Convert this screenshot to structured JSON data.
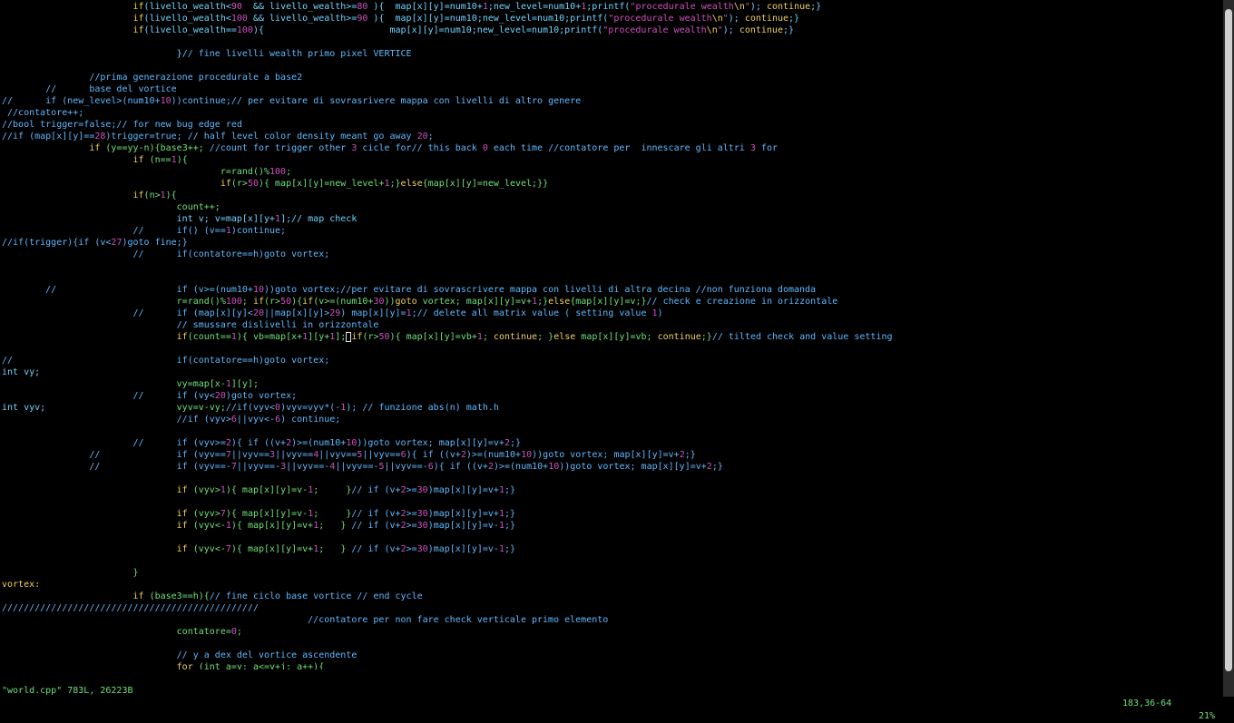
{
  "colors": {
    "background": "#000000",
    "default": "#6fd3ff",
    "keyword": "#f0d060",
    "number": "#d050c0",
    "string": "#d050c0",
    "comment": "#5fb8ff",
    "identifier": "#6fe07a",
    "status": "#6fe07a",
    "scrollbar": "#2b2b2b",
    "scroll_thumb": "#cfcfcf"
  },
  "editor": {
    "lines": [
      [
        [
          "d",
          "                        "
        ],
        [
          "k",
          "if"
        ],
        [
          "d",
          "(livello_wealth<"
        ],
        [
          "n",
          "90"
        ],
        [
          "d",
          "  && livello_wealth>="
        ],
        [
          "n",
          "80"
        ],
        [
          "d",
          " ){  map[x][y]=num10+"
        ],
        [
          "n",
          "1"
        ],
        [
          "d",
          ";new_level=num10+"
        ],
        [
          "n",
          "1"
        ],
        [
          "d",
          ";printf("
        ],
        [
          "s",
          "\"procedurale wealth"
        ],
        [
          "k",
          "\\n"
        ],
        [
          "s",
          "\""
        ],
        [
          "d",
          "); "
        ],
        [
          "k",
          "continue"
        ],
        [
          "d",
          ";}"
        ]
      ],
      [
        [
          "d",
          "                        "
        ],
        [
          "k",
          "if"
        ],
        [
          "d",
          "(livello_wealth<"
        ],
        [
          "n",
          "100"
        ],
        [
          "d",
          " && livello_wealth>="
        ],
        [
          "n",
          "90"
        ],
        [
          "d",
          " ){  map[x][y]=num10;new_level=num10;printf("
        ],
        [
          "s",
          "\"procedurale wealth"
        ],
        [
          "k",
          "\\n"
        ],
        [
          "s",
          "\""
        ],
        [
          "d",
          "); "
        ],
        [
          "k",
          "continue"
        ],
        [
          "d",
          ";}"
        ]
      ],
      [
        [
          "d",
          "                        "
        ],
        [
          "k",
          "if"
        ],
        [
          "d",
          "(livello_wealth=="
        ],
        [
          "n",
          "100"
        ],
        [
          "d",
          "){                       map[x][y]=num10;new_level=num10;printf("
        ],
        [
          "s",
          "\"procedurale wealth"
        ],
        [
          "k",
          "\\n"
        ],
        [
          "s",
          "\""
        ],
        [
          "d",
          "); "
        ],
        [
          "k",
          "continue"
        ],
        [
          "d",
          ";}"
        ]
      ],
      [],
      [
        [
          "d",
          "                                }"
        ],
        [
          "c",
          "// fine livelli wealth primo pixel VERTICE"
        ]
      ],
      [],
      [
        [
          "c",
          "                //prima generazione procedurale a base2"
        ]
      ],
      [
        [
          "c",
          "        //      base del vortice"
        ]
      ],
      [
        [
          "c",
          "//      if (new_level>(num10+"
        ],
        [
          "n",
          "10"
        ],
        [
          "c",
          "))continue;// per evitare di sovrasrivere mappa con livelli di altro genere"
        ]
      ],
      [
        [
          "c",
          " //contatore++;"
        ]
      ],
      [
        [
          "c",
          "//bool trigger=false;// for new bug edge red"
        ]
      ],
      [
        [
          "c",
          "//if (map[x][y]=="
        ],
        [
          "n",
          "28"
        ],
        [
          "c",
          ")trigger=true; // half level color density meant go away "
        ],
        [
          "n",
          "20"
        ],
        [
          "c",
          ";"
        ]
      ],
      [
        [
          "d",
          "                "
        ],
        [
          "k",
          "if"
        ],
        [
          "d",
          " "
        ],
        [
          "i",
          "(y==yy-n){base3++;"
        ],
        [
          "c",
          " //count for trigger other "
        ],
        [
          "n",
          "3"
        ],
        [
          "c",
          " cicle for// this back "
        ],
        [
          "n",
          "0"
        ],
        [
          "c",
          " each time //contatore per  innescare gli altri "
        ],
        [
          "n",
          "3"
        ],
        [
          "c",
          " for"
        ]
      ],
      [
        [
          "d",
          "                        "
        ],
        [
          "k",
          "if"
        ],
        [
          "d",
          " "
        ],
        [
          "i",
          "(n=="
        ],
        [
          "n",
          "1"
        ],
        [
          "i",
          "){"
        ]
      ],
      [
        [
          "d",
          "                                        "
        ],
        [
          "i",
          "r=rand()%"
        ],
        [
          "n",
          "100"
        ],
        [
          "i",
          ";"
        ]
      ],
      [
        [
          "d",
          "                                        "
        ],
        [
          "k",
          "if"
        ],
        [
          "i",
          "(r>"
        ],
        [
          "n",
          "50"
        ],
        [
          "i",
          "){ map[x][y]=new_level+"
        ],
        [
          "n",
          "1"
        ],
        [
          "i",
          ";}"
        ],
        [
          "k",
          "else"
        ],
        [
          "i",
          "{map[x][y]=new_level;}}"
        ]
      ],
      [
        [
          "d",
          "                        "
        ],
        [
          "k",
          "if"
        ],
        [
          "i",
          "(n>"
        ],
        [
          "n",
          "1"
        ],
        [
          "i",
          "){"
        ]
      ],
      [
        [
          "d",
          "                                "
        ],
        [
          "i",
          "count++;"
        ]
      ],
      [
        [
          "d",
          "                                "
        ],
        [
          "d",
          "int v; v=map[x][y+"
        ],
        [
          "n",
          "1"
        ],
        [
          "d",
          "];// map check"
        ]
      ],
      [
        [
          "c",
          "                        //      if() (v=="
        ],
        [
          "n",
          "1"
        ],
        [
          "c",
          ")continue;"
        ]
      ],
      [
        [
          "c",
          "//if(trigger){if (v<"
        ],
        [
          "n",
          "27"
        ],
        [
          "c",
          ")goto fine;}"
        ]
      ],
      [
        [
          "c",
          "                        //      if(contatore==h)goto vortex;"
        ]
      ],
      [],
      [],
      [
        [
          "c",
          "        //                      if (v>=(num10+"
        ],
        [
          "n",
          "10"
        ],
        [
          "c",
          "))goto vortex;//per evitare di sovrascrivere mappa con livelli di altra decina //non funziona domanda"
        ]
      ],
      [
        [
          "d",
          "                                "
        ],
        [
          "i",
          "r=rand()%"
        ],
        [
          "n",
          "100"
        ],
        [
          "i",
          "; "
        ],
        [
          "k",
          "if"
        ],
        [
          "i",
          "(r>"
        ],
        [
          "n",
          "50"
        ],
        [
          "i",
          "){"
        ],
        [
          "k",
          "if"
        ],
        [
          "i",
          "(v>=(num10+"
        ],
        [
          "n",
          "30"
        ],
        [
          "i",
          "))"
        ],
        [
          "k",
          "goto"
        ],
        [
          "i",
          " vortex; map[x][y]=v+"
        ],
        [
          "n",
          "1"
        ],
        [
          "i",
          ";}"
        ],
        [
          "k",
          "else"
        ],
        [
          "i",
          "{map[x][y]=v;}"
        ],
        [
          "c",
          "// check e creazione in orizzontale"
        ]
      ],
      [
        [
          "c",
          "                        //      if (map[x][y]<"
        ],
        [
          "n",
          "20"
        ],
        [
          "c",
          "||map[x][y]>"
        ],
        [
          "n",
          "29"
        ],
        [
          "c",
          ") map[x][y]="
        ],
        [
          "n",
          "1"
        ],
        [
          "c",
          ";// delete all matrix value ( setting value "
        ],
        [
          "n",
          "1"
        ],
        [
          "c",
          ")"
        ]
      ],
      [
        [
          "c",
          "                                // smussare dislivelli in orizzontale"
        ]
      ],
      [
        [
          "d",
          "                                "
        ],
        [
          "k",
          "if"
        ],
        [
          "i",
          "(count=="
        ],
        [
          "n",
          "1"
        ],
        [
          "i",
          "){ vb=map[x+"
        ],
        [
          "n",
          "1"
        ],
        [
          "i",
          "][y+"
        ],
        [
          "n",
          "1"
        ],
        [
          "i",
          "];"
        ],
        [
          "cur",
          " "
        ],
        [
          "k",
          "if"
        ],
        [
          "i",
          "(r>"
        ],
        [
          "n",
          "50"
        ],
        [
          "i",
          "){ map[x][y]=vb+"
        ],
        [
          "n",
          "1"
        ],
        [
          "i",
          "; "
        ],
        [
          "k",
          "continue"
        ],
        [
          "i",
          "; }"
        ],
        [
          "k",
          "else"
        ],
        [
          "i",
          " map[x][y]=vb; "
        ],
        [
          "k",
          "continue"
        ],
        [
          "i",
          ";}"
        ],
        [
          "c",
          "// tilted check and value setting"
        ]
      ],
      [],
      [
        [
          "c",
          "//                              if(contatore==h)goto vortex;"
        ]
      ],
      [
        [
          "d",
          "int vy;"
        ]
      ],
      [
        [
          "d",
          "                                "
        ],
        [
          "i",
          "vy=map[x-"
        ],
        [
          "n",
          "1"
        ],
        [
          "i",
          "][y];"
        ]
      ],
      [
        [
          "c",
          "                        //      if (vy<"
        ],
        [
          "n",
          "20"
        ],
        [
          "c",
          ")goto vortex;"
        ]
      ],
      [
        [
          "d",
          "int vyv;                        "
        ],
        [
          "i",
          "vyv=v-vy;"
        ],
        [
          "c",
          "//if(vyv<"
        ],
        [
          "n",
          "0"
        ],
        [
          "c",
          ")vyv=vyv*(-"
        ],
        [
          "n",
          "1"
        ],
        [
          "c",
          "); // funzione abs(n) math.h"
        ]
      ],
      [
        [
          "c",
          "                                //if (vyv>"
        ],
        [
          "n",
          "6"
        ],
        [
          "c",
          "||vyv<-"
        ],
        [
          "n",
          "6"
        ],
        [
          "c",
          ") continue;"
        ]
      ],
      [],
      [
        [
          "c",
          "                        //      if (vyv>="
        ],
        [
          "n",
          "2"
        ],
        [
          "c",
          "){ if ((v+"
        ],
        [
          "n",
          "2"
        ],
        [
          "c",
          ")>=(num10+"
        ],
        [
          "n",
          "10"
        ],
        [
          "c",
          "))goto vortex; map[x][y]=v+"
        ],
        [
          "n",
          "2"
        ],
        [
          "c",
          ";}"
        ]
      ],
      [
        [
          "c",
          "                //              if (vyv=="
        ],
        [
          "n",
          "7"
        ],
        [
          "c",
          "||vyv=="
        ],
        [
          "n",
          "3"
        ],
        [
          "c",
          "||vyv=="
        ],
        [
          "n",
          "4"
        ],
        [
          "c",
          "||vyv=="
        ],
        [
          "n",
          "5"
        ],
        [
          "c",
          "||vyv=="
        ],
        [
          "n",
          "6"
        ],
        [
          "c",
          "){ if ((v+"
        ],
        [
          "n",
          "2"
        ],
        [
          "c",
          ")>=(num10+"
        ],
        [
          "n",
          "10"
        ],
        [
          "c",
          "))goto vortex; map[x][y]=v+"
        ],
        [
          "n",
          "2"
        ],
        [
          "c",
          ";}"
        ]
      ],
      [
        [
          "c",
          "                //              if (vyv==-"
        ],
        [
          "n",
          "7"
        ],
        [
          "c",
          "||vyv==-"
        ],
        [
          "n",
          "3"
        ],
        [
          "c",
          "||vyv==-"
        ],
        [
          "n",
          "4"
        ],
        [
          "c",
          "||vyv==-"
        ],
        [
          "n",
          "5"
        ],
        [
          "c",
          "||vyv==-"
        ],
        [
          "n",
          "6"
        ],
        [
          "c",
          "){ if ((v+"
        ],
        [
          "n",
          "2"
        ],
        [
          "c",
          ")>=(num10+"
        ],
        [
          "n",
          "10"
        ],
        [
          "c",
          "))goto vortex; map[x][y]=v+"
        ],
        [
          "n",
          "2"
        ],
        [
          "c",
          ";}"
        ]
      ],
      [],
      [
        [
          "d",
          "                                "
        ],
        [
          "k",
          "if"
        ],
        [
          "d",
          " "
        ],
        [
          "i",
          "(vyv>"
        ],
        [
          "n",
          "1"
        ],
        [
          "i",
          "){ map[x][y]=v-"
        ],
        [
          "n",
          "1"
        ],
        [
          "i",
          ";     }"
        ],
        [
          "c",
          "// if (v+"
        ],
        [
          "n",
          "2"
        ],
        [
          "c",
          ">="
        ],
        [
          "n",
          "30"
        ],
        [
          "c",
          ")map[x][y]=v+"
        ],
        [
          "n",
          "1"
        ],
        [
          "c",
          ";}"
        ]
      ],
      [],
      [
        [
          "d",
          "                                "
        ],
        [
          "k",
          "if"
        ],
        [
          "d",
          " "
        ],
        [
          "i",
          "(vyv>"
        ],
        [
          "n",
          "7"
        ],
        [
          "i",
          "){ map[x][y]=v-"
        ],
        [
          "n",
          "1"
        ],
        [
          "i",
          ";     }"
        ],
        [
          "c",
          "// if (v+"
        ],
        [
          "n",
          "2"
        ],
        [
          "c",
          ">="
        ],
        [
          "n",
          "30"
        ],
        [
          "c",
          ")map[x][y]=v+"
        ],
        [
          "n",
          "1"
        ],
        [
          "c",
          ";}"
        ]
      ],
      [
        [
          "d",
          "                                "
        ],
        [
          "k",
          "if"
        ],
        [
          "d",
          " "
        ],
        [
          "i",
          "(vyv<-"
        ],
        [
          "n",
          "1"
        ],
        [
          "i",
          "){ map[x][y]=v+"
        ],
        [
          "n",
          "1"
        ],
        [
          "i",
          ";   }"
        ],
        [
          "c",
          " // if (v+"
        ],
        [
          "n",
          "2"
        ],
        [
          "c",
          ">="
        ],
        [
          "n",
          "30"
        ],
        [
          "c",
          ")map[x][y]=v-"
        ],
        [
          "n",
          "1"
        ],
        [
          "c",
          ";}"
        ]
      ],
      [],
      [
        [
          "d",
          "                                "
        ],
        [
          "k",
          "if"
        ],
        [
          "d",
          " "
        ],
        [
          "i",
          "(vyv<-"
        ],
        [
          "n",
          "7"
        ],
        [
          "i",
          "){ map[x][y]=v+"
        ],
        [
          "n",
          "1"
        ],
        [
          "i",
          ";   }"
        ],
        [
          "c",
          " // if (v+"
        ],
        [
          "n",
          "2"
        ],
        [
          "c",
          ">="
        ],
        [
          "n",
          "30"
        ],
        [
          "c",
          ")map[x][y]=v-"
        ],
        [
          "n",
          "1"
        ],
        [
          "c",
          ";}"
        ]
      ],
      [],
      [
        [
          "d",
          "                        "
        ],
        [
          "i",
          "}"
        ]
      ],
      [
        [
          "k",
          "vortex:"
        ]
      ],
      [
        [
          "d",
          "                        "
        ],
        [
          "k",
          "if"
        ],
        [
          "d",
          " "
        ],
        [
          "i",
          "(base3==h){"
        ],
        [
          "c",
          "// fine ciclo base vortice // end cycle"
        ]
      ],
      [
        [
          "c",
          "///////////////////////////////////////////////"
        ]
      ],
      [
        [
          "c",
          "                                                        //contatore per non fare check verticale primo elemento"
        ]
      ],
      [
        [
          "d",
          "                                "
        ],
        [
          "i",
          "contatore="
        ],
        [
          "n",
          "0"
        ],
        [
          "i",
          ";"
        ]
      ],
      [],
      [
        [
          "c",
          "                                // y a dex del vortice ascendente"
        ]
      ],
      [
        [
          "d",
          "                                "
        ],
        [
          "k",
          "for"
        ],
        [
          "d",
          " "
        ],
        [
          "i",
          "(int a=y; a<=y+j; a++){"
        ]
      ]
    ]
  },
  "status": {
    "file": "\"world.cpp\" 783L, 26223B",
    "position": "183,36-64",
    "percent": "21%"
  },
  "scroll": {
    "fraction": 0.21
  }
}
